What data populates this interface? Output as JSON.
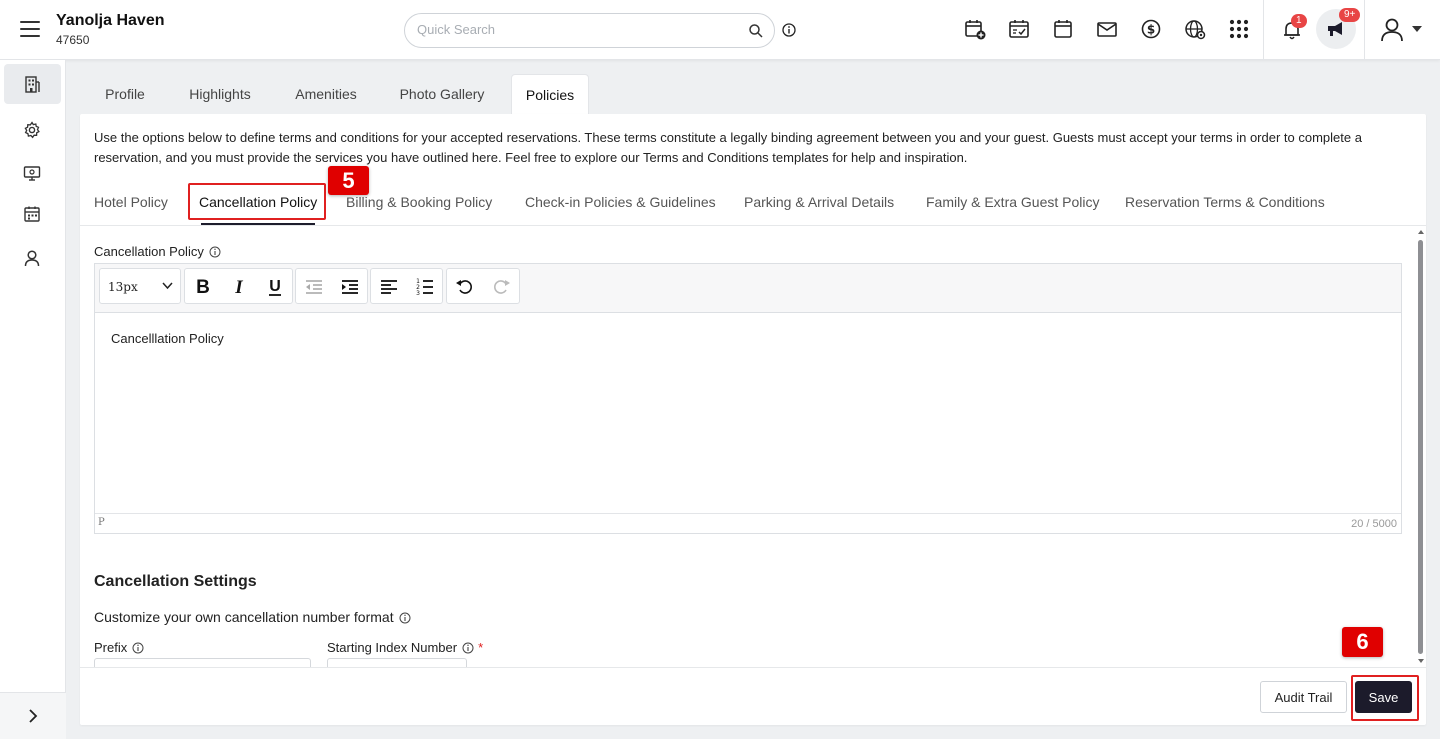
{
  "header": {
    "hotel_name": "Yanolja Haven",
    "hotel_id": "47650",
    "search_placeholder": "Quick Search",
    "notifications_count": "1",
    "announcements_count": "9+"
  },
  "tabs": [
    "Profile",
    "Highlights",
    "Amenities",
    "Photo Gallery",
    "Policies"
  ],
  "active_tab": "Policies",
  "intro_text": "Use the options below to define terms and conditions for your accepted reservations. These terms constitute a legally binding agreement between you and your guest. Guests must accept your terms in order to complete a reservation, and you must provide the services you have outlined here. Feel free to explore our Terms and Conditions templates for help and inspiration.",
  "policy_tabs": [
    "Hotel Policy",
    "Cancellation Policy",
    "Billing & Booking Policy",
    "Check-in Policies & Guidelines",
    "Parking & Arrival Details",
    "Family & Extra Guest Policy",
    "Reservation Terms & Conditions"
  ],
  "active_policy_tab": "Cancellation Policy",
  "markers": {
    "step5": "5",
    "step6": "6"
  },
  "editor": {
    "label": "Cancellation Policy",
    "font_size": "13px",
    "content": "Cancelllation Policy",
    "path": "P",
    "char_count": "20 / 5000"
  },
  "cancellation_settings": {
    "title": "Cancellation Settings",
    "subtitle": "Customize your own cancellation number format",
    "prefix_label": "Prefix",
    "starting_index_label": "Starting Index Number",
    "required_mark": "*"
  },
  "footer": {
    "audit_label": "Audit Trail",
    "save_label": "Save"
  },
  "colors": {
    "primary_button": "#1c1b2b",
    "highlight": "#e02020",
    "badge": "#e84545"
  }
}
